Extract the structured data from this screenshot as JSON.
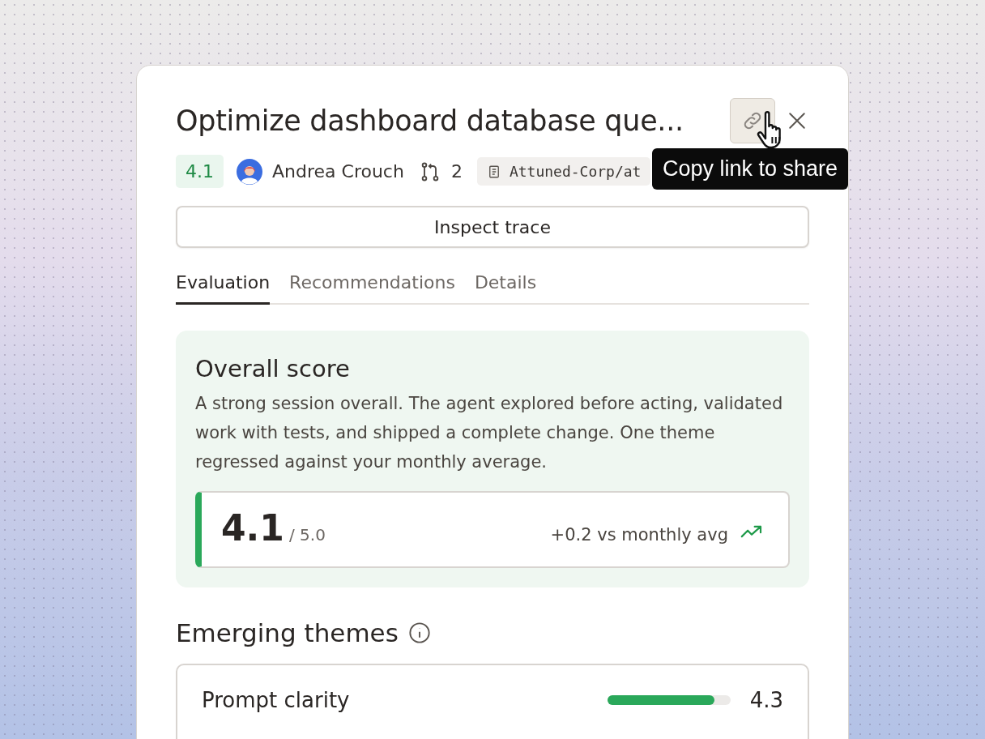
{
  "title": "Optimize dashboard database que...",
  "tooltip": "Copy link to share",
  "meta": {
    "score": "4.1",
    "author": "Andrea Crouch",
    "pull_requests": "2",
    "repo": "Attuned-Corp/at"
  },
  "inspect_button": "Inspect trace",
  "tabs": [
    {
      "label": "Evaluation",
      "selected": true
    },
    {
      "label": "Recommendations",
      "selected": false
    },
    {
      "label": "Details",
      "selected": false
    }
  ],
  "overall": {
    "title": "Overall score",
    "summary": "A strong session overall. The agent explored before acting, validated work with tests, and shipped a complete change. One theme regressed against your monthly average.",
    "score": "4.1",
    "out_of": "/ 5.0",
    "comparison": "+0.2 vs monthly avg"
  },
  "themes_title": "Emerging themes",
  "themes": [
    {
      "name": "Prompt clarity",
      "level": 0.87,
      "score": "4.3"
    }
  ]
}
